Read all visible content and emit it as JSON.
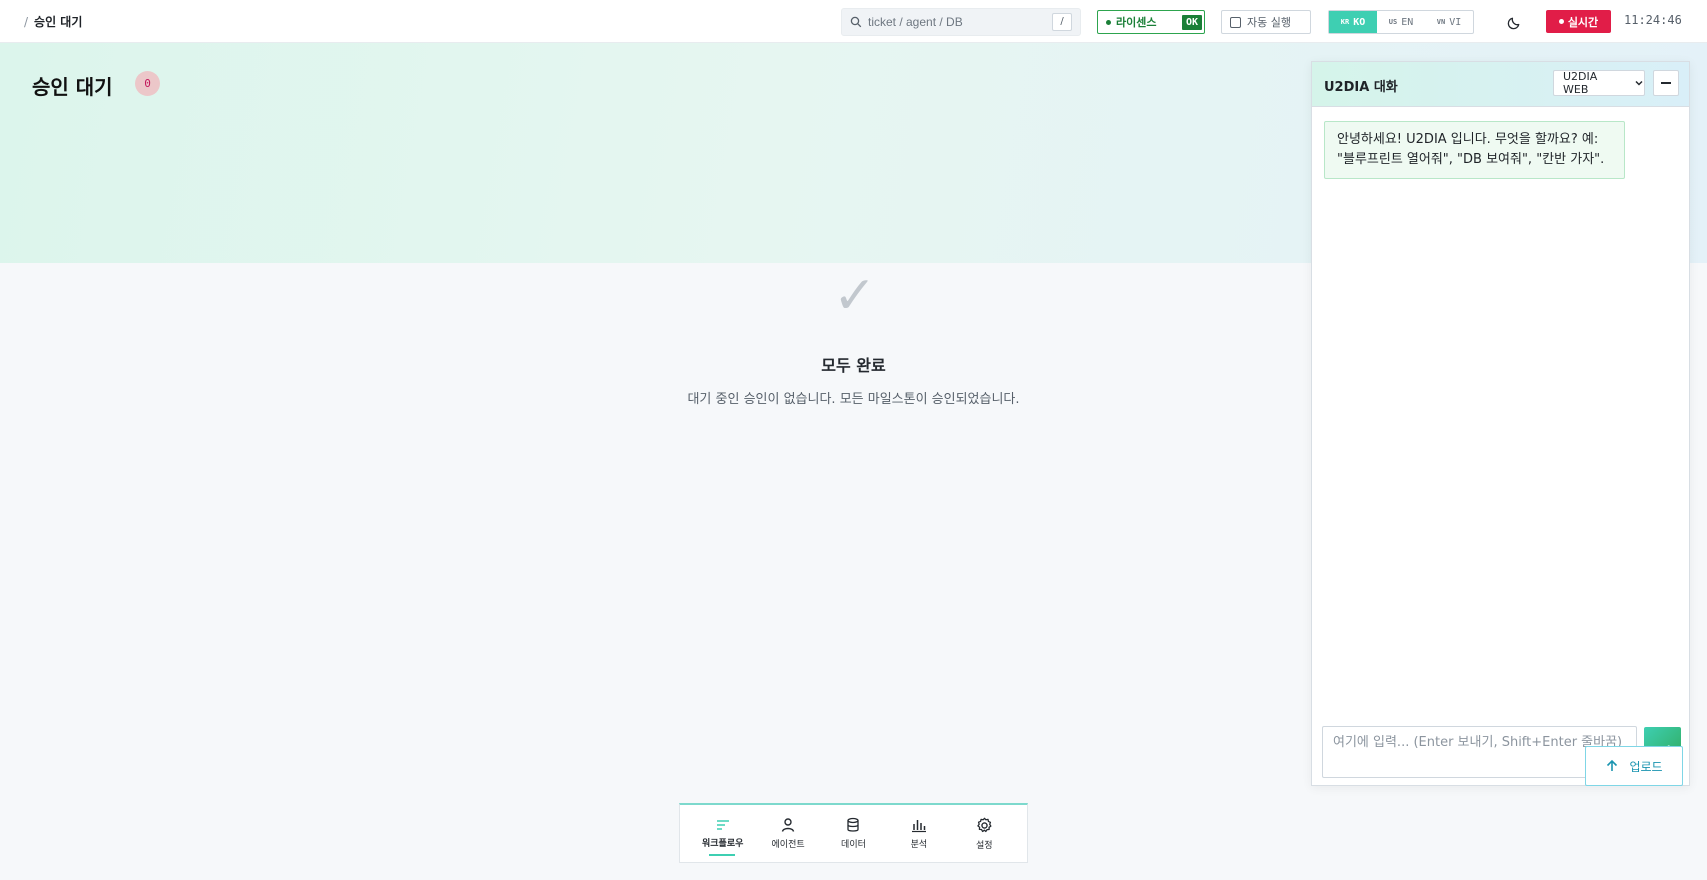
{
  "breadcrumb": {
    "separator": "/",
    "current": "승인 대기"
  },
  "search": {
    "placeholder": "ticket / agent / DB",
    "shortcut": "/"
  },
  "license": {
    "label": "라이센스",
    "status": "OK"
  },
  "autoplay": {
    "label": "자동 실행",
    "checked": false
  },
  "languages": [
    {
      "flag": "KR",
      "code": "KO",
      "active": true
    },
    {
      "flag": "US",
      "code": "EN",
      "active": false
    },
    {
      "flag": "VN",
      "code": "VI",
      "active": false
    }
  ],
  "theme_icon": "moon-icon",
  "live": {
    "label": "실시간"
  },
  "clock": "11:24:46",
  "page": {
    "title": "승인 대기",
    "count": "0"
  },
  "empty_state": {
    "icon": "check-icon",
    "glyph": "✓",
    "title": "모두 완료",
    "description": "대기 중인 승인이 없습니다. 모든 마일스톤이 승인되었습니다."
  },
  "chat": {
    "title": "U2DIA 대화",
    "channel_selected": "U2DIA WEB",
    "greeting": "안녕하세요! U2DIA 입니다. 무엇을 할까요? 예: \"블루프린트 열어줘\", \"DB 보여줘\", \"칸반 가자\".",
    "input_placeholder": "여기에 입력... (Enter 보내기, Shift+Enter 줄바꿈)",
    "upload_label": "업로드"
  },
  "bottom_nav": [
    {
      "label": "워크플로우",
      "icon": "workflow-icon",
      "active": true
    },
    {
      "label": "에이전트",
      "icon": "person-icon",
      "active": false
    },
    {
      "label": "데이터",
      "icon": "database-icon",
      "active": false
    },
    {
      "label": "분석",
      "icon": "bar-chart-icon",
      "active": false
    },
    {
      "label": "설정",
      "icon": "gear-icon",
      "active": false
    }
  ],
  "colors": {
    "accent": "#3ecfb2",
    "live": "#e11d48",
    "license": "#1a7f37"
  }
}
